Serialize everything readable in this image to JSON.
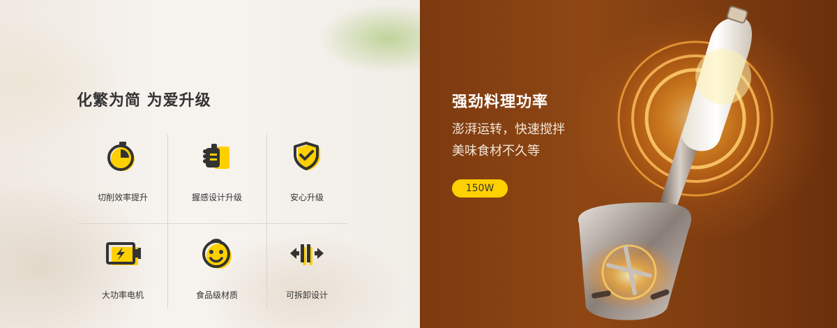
{
  "left": {
    "title": "化繁为简 为爱升级",
    "features": [
      {
        "label": "切削效率提升",
        "icon": "stopwatch-icon"
      },
      {
        "label": "握感设计升级",
        "icon": "grip-hand-icon"
      },
      {
        "label": "安心升级",
        "icon": "shield-check-icon"
      },
      {
        "label": "大功率电机",
        "icon": "motor-battery-icon"
      },
      {
        "label": "食品级材质",
        "icon": "baby-face-icon"
      },
      {
        "label": "可拆卸设计",
        "icon": "detachable-arrows-icon"
      }
    ]
  },
  "right": {
    "title": "强劲料理功率",
    "subtitle_line1": "澎湃运转，快速搅拌",
    "subtitle_line2": "美味食材不久等",
    "power_badge": "150W"
  },
  "colors": {
    "accent_yellow": "#ffd000",
    "icon_dark": "#333333",
    "right_bg": "#8e4714"
  }
}
